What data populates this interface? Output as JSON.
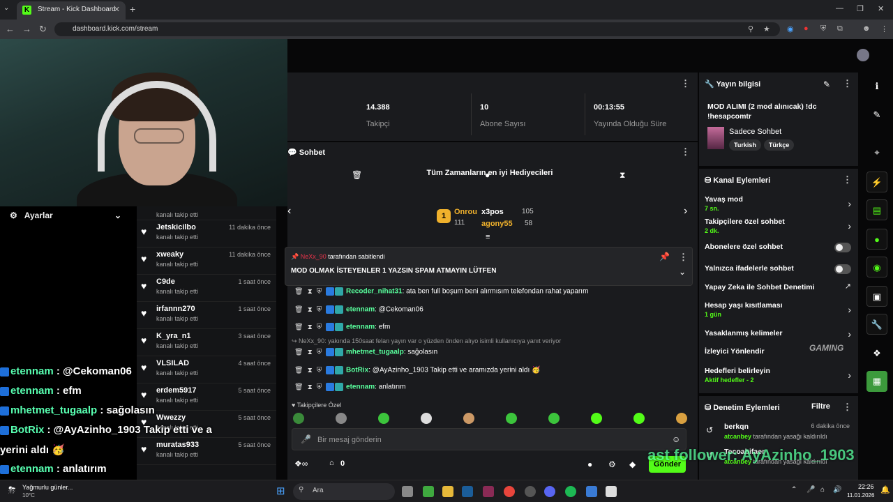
{
  "browser": {
    "tab_title": "Stream - Kick Dashboard",
    "url": "dashboard.kick.com/stream",
    "favicon": "K"
  },
  "settings_label": "Ayarlar",
  "overlay_chat": [
    {
      "name": "etennam",
      "text": " : @Cekoman06"
    },
    {
      "name": "etennam",
      "text": " : efm"
    },
    {
      "name": "mhetmet_tugaalp",
      "text": " : sağolasın"
    },
    {
      "name": "BotRix",
      "text": " : @AyAzinho_1903 Takip etti ve a"
    },
    {
      "name": "",
      "text": "yerini aldı 🥳"
    },
    {
      "name": "etennam",
      "text": " : anlatırım"
    }
  ],
  "followers": [
    {
      "name": "",
      "sub": "kanalı takip etti",
      "time": ""
    },
    {
      "name": "Jetskicilbo",
      "sub": "kanalı takip etti",
      "time": "11 dakika önce"
    },
    {
      "name": "xweaky",
      "sub": "kanalı takip etti",
      "time": "11 dakika önce"
    },
    {
      "name": "C9de",
      "sub": "kanalı takip etti",
      "time": "1 saat önce"
    },
    {
      "name": "irfannn270",
      "sub": "kanalı takip etti",
      "time": "1 saat önce"
    },
    {
      "name": "K_yra_n1",
      "sub": "kanalı takip etti",
      "time": "3 saat önce"
    },
    {
      "name": "VLSILAD",
      "sub": "kanalı takip etti",
      "time": "4 saat önce"
    },
    {
      "name": "erdem5917",
      "sub": "kanalı takip etti",
      "time": "5 saat önce"
    },
    {
      "name": "Wwezzy",
      "sub": "kanalı takip etti",
      "time": "5 saat önce"
    },
    {
      "name": "muratas933",
      "sub": "kanalı takip etti",
      "time": "5 saat önce"
    }
  ],
  "stats": [
    {
      "value": "14.388",
      "label": "Takipçi"
    },
    {
      "value": "10",
      "label": "Abone Sayısı"
    },
    {
      "value": "00:13:55",
      "label": "Yayında Olduğu Süre"
    }
  ],
  "chat": {
    "title": "Sohbet",
    "gifters_title": "Tüm Zamanların en iyi Hediyecileri",
    "gifters": [
      {
        "name": "Onrou",
        "count": "111"
      },
      {
        "name": "x3pos",
        "count": "105"
      },
      {
        "name": "agony55",
        "count": "58"
      }
    ],
    "pinned_by_name": "NeXx_90",
    "pinned_by_suffix": "tarafından sabitlendi",
    "pinned_text": "MOD OLMAK İSTEYENLER 1 YAZSIN SPAM ATMAYIN LÜTFEN",
    "messages": [
      {
        "user": "Recoder_nihat31",
        "text": ": ata ben full boşum beni alırmısım telefondan rahat yaparım"
      },
      {
        "user": "etennam",
        "text": ": @Cekoman06"
      },
      {
        "user": "etennam",
        "text": ": efm"
      },
      {
        "reply": "NeXx_90: yakında 150saat felan yayın var o yüzden önden alıyo isimli kullanıcıya yanıt veriyor"
      },
      {
        "user": "mhetmet_tugaalp",
        "text": ": sağolasın"
      },
      {
        "user": "BotRix",
        "text": ": @AyAzinho_1903 Takip etti ve aramızda yerini aldı 🥳"
      },
      {
        "user": "etennam",
        "text": ": anlatırım"
      }
    ],
    "emote_section": "Takipçilere Özel",
    "input_placeholder": "Bir mesaj gönderin",
    "points": "0",
    "send_label": "Gönder"
  },
  "stream_info": {
    "title": "Yayın bilgisi",
    "stream_title": "MOD ALIMI (2 mod alınıcak) !dc !hesapcomtr",
    "category": "Sadece Sohbet",
    "tags": [
      "Turkish",
      "Türkçe"
    ]
  },
  "channel_actions": {
    "title": "Kanal Eylemleri",
    "items": [
      {
        "label": "Yavaş mod",
        "sub": "7 sn."
      },
      {
        "label": "Takipçilere özel sohbet",
        "sub": "2 dk."
      },
      {
        "label": "Abonelere özel sohbet",
        "sub": ""
      },
      {
        "label": "Yalnızca ifadelerle sohbet",
        "sub": ""
      },
      {
        "label": "Yapay Zeka ile Sohbet Denetimi",
        "sub": ""
      },
      {
        "label": "Hesap yaşı kısıtlaması",
        "sub": "1 gün"
      },
      {
        "label": "Yasaklanmış kelimeler",
        "sub": ""
      },
      {
        "label": "İzleyici Yönlendir",
        "sub": ""
      },
      {
        "label": "Hedefleri belirleyin",
        "sub": "Aktif hedefler - 2"
      }
    ]
  },
  "moderation": {
    "title": "Denetim Eylemleri",
    "filter": "Filtre",
    "items": [
      {
        "user": "berkqn",
        "by": "atcanbey",
        "suffix": "tarafından yasağı kaldırıldı",
        "time": "6 dakika önce"
      },
      {
        "user": "Tecoabifaer",
        "by": "atcanbey",
        "suffix": "tarafından yasağı kaldırıldı",
        "time": ""
      }
    ]
  },
  "overlay_follow": "ast follower: AyAzinho_1903",
  "watermark": "GAMING",
  "taskbar": {
    "weather": "Yağmurlu günler...",
    "temp": "10°C",
    "search": "Ara",
    "time": "22:26",
    "date": "11.01.2026"
  },
  "colors": {
    "kick_green": "#53fc18",
    "chat_name": "#58ff9d",
    "panel": "#1a1b1e"
  }
}
